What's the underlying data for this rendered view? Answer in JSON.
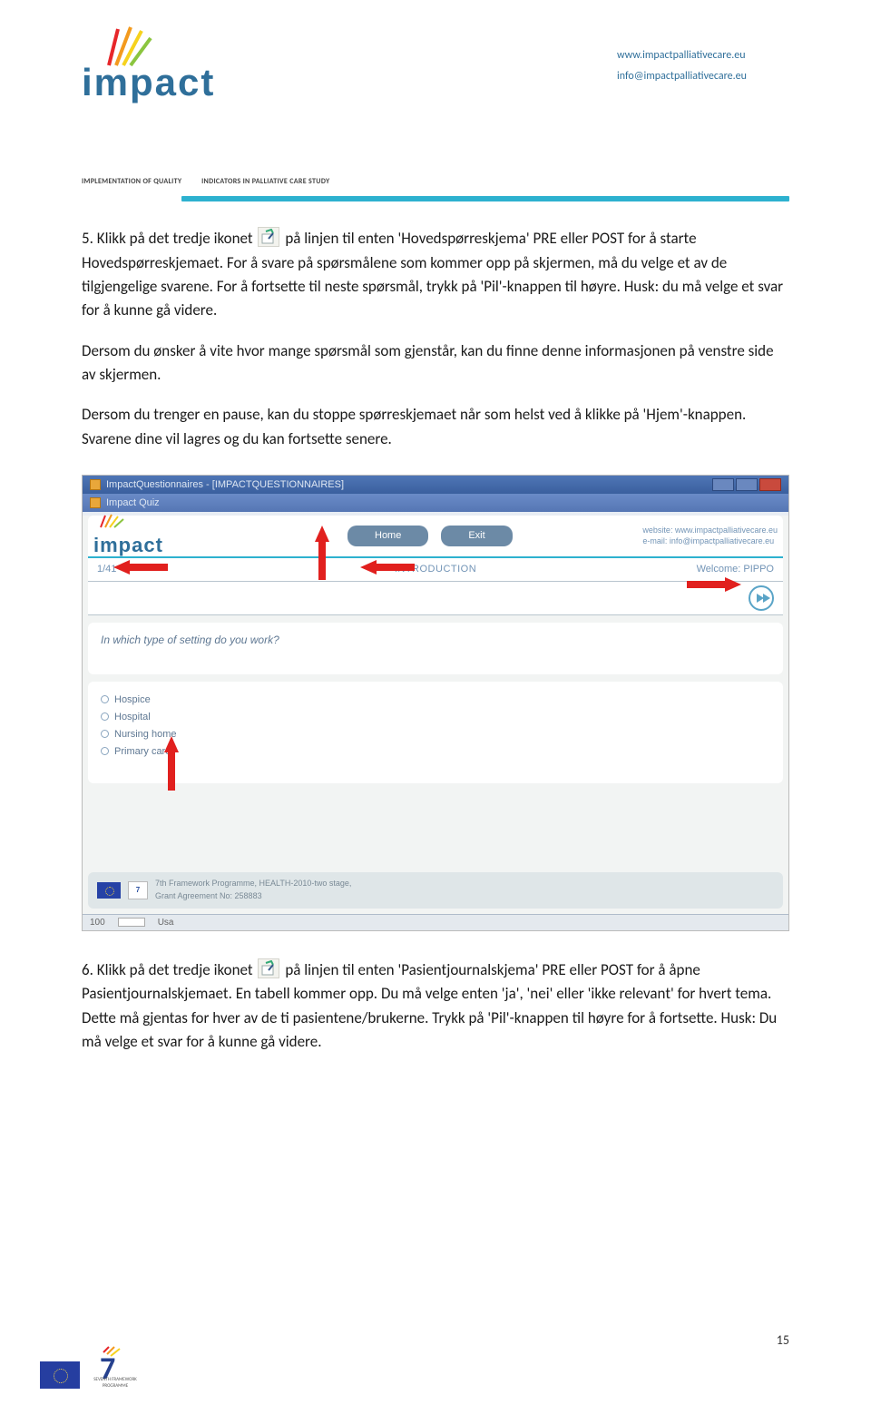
{
  "header": {
    "logo_text": "impact",
    "logo_subline_a": "IMPLEMENTATION OF QUALITY",
    "logo_subline_b": "INDICATORS IN PALLIATIVE CARE STUDY",
    "url": "www.impactpalliativecare.eu",
    "email": "info@impactpalliativecare.eu"
  },
  "para1a": "5. Klikk på det tredje ikonet ",
  "para1b": " på linjen til enten 'Hovedspørreskjema' PRE eller POST for å starte Hovedspørreskjemaet. For å svare på spørsmålene som kommer opp på skjermen, må du velge et av de tilgjengelige svarene. For å fortsette til neste spørsmål, trykk på 'Pil'-knappen til høyre. Husk: du må velge et svar for å kunne gå videre.",
  "para2": "Dersom du ønsker å vite hvor mange spørsmål som gjenstår, kan du finne denne informasjonen på venstre side av skjermen.",
  "para3": "Dersom du trenger en pause, kan du stoppe spørreskjemaet når som helst ved å klikke på 'Hjem'-knappen. Svarene dine vil lagres og du kan fortsette senere.",
  "screenshot": {
    "title1": "ImpactQuestionnaires - [IMPACTQUESTIONNAIRES]",
    "title2": "Impact Quiz",
    "logo_text": "impact",
    "btn_home": "Home",
    "btn_exit": "Exit",
    "top_right1": "website: www.impactpalliativecare.eu",
    "top_right2": "e-mail: info@impactpalliativecare.eu",
    "progress": "1/41",
    "section": "INTRODUCTION",
    "welcome": "Welcome: PIPPO",
    "question": "In which type of setting do you work?",
    "answers": [
      "Hospice",
      "Hospital",
      "Nursing home",
      "Primary care"
    ],
    "footer_line1": "7th Framework Programme, HEALTH-2010-two stage,",
    "footer_line2": "Grant Agreement No: 258883",
    "status_left": "100",
    "status_mid": "Usa"
  },
  "para4a": "6. Klikk på det tredje ikonet ",
  "para4b": " på linjen til enten 'Pasientjournalskjema' PRE eller POST for å åpne Pasientjournalskjemaet. En tabell kommer opp. Du må velge enten 'ja', 'nei' eller 'ikke relevant' for hvert tema. Dette må gjentas for hver av de ti pasientene/brukerne. Trykk på 'Pil'-knappen til høyre for å fortsette. Husk: Du må velge et svar for å kunne gå videre.",
  "page_number": "15",
  "footer": {
    "fp7_label": "SEVENTH FRAMEWORK PROGRAMME"
  }
}
